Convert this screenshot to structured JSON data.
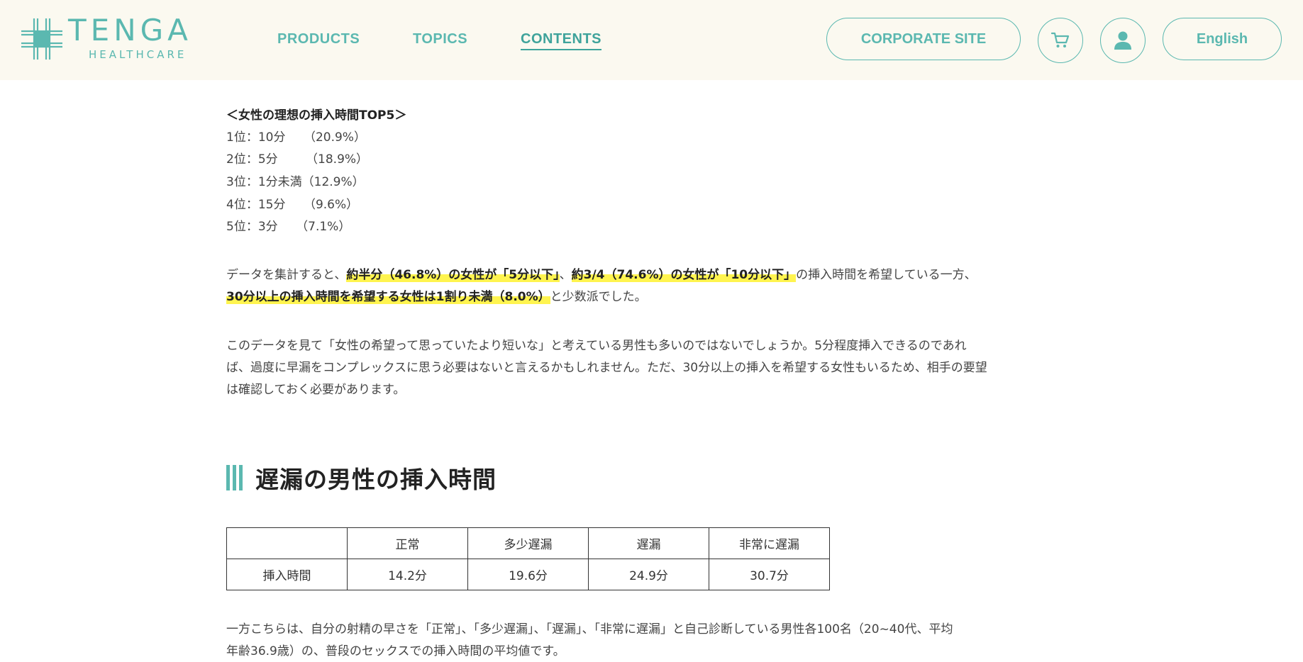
{
  "header": {
    "logo": {
      "word": "TENGA",
      "sub": "HEALTHCARE",
      "icon": "tenga-cross-icon"
    },
    "nav": [
      {
        "label": "PRODUCTS",
        "active": false
      },
      {
        "label": "TOPICS",
        "active": false
      },
      {
        "label": "CONTENTS",
        "active": true
      }
    ],
    "corporate_site": "CORPORATE SITE",
    "cart_icon": "cart-icon",
    "account_icon": "user-icon",
    "language": "English",
    "accent_color": "#5bb8b0",
    "background_color": "#fbf9f0"
  },
  "ranking": {
    "title": "＜女性の理想の挿入時間TOP5＞",
    "items": [
      "1位：10分　　（20.9%）",
      "2位：5分　　 （18.9%）",
      "3位：1分未満（12.9%）",
      "4位：15分　　（9.6%）",
      "5位：3分　　（7.1%）"
    ]
  },
  "summary": {
    "line1_pre": "データを集計すると、",
    "line1_hl1": "約半分（46.8%）の女性が「5分以下」",
    "line1_mid": "、",
    "line1_hl2": "約3/4（74.6%）の女性が「10分以下」",
    "line1_post": "の挿入時間を希望している一方、",
    "line2_hl": "30分以上の挿入時間を希望する女性は1割り未満（8.0%）",
    "line2_post": "と少数派でした。",
    "highlight_color": "#fff44f"
  },
  "commentary": [
    "このデータを見て「女性の希望って思っていたより短いな」と考えている男性も多いのではないでしょうか。5分程度挿入できるのであれ",
    "ば、過度に早漏をコンプレックスに思う必要はないと言えるかもしれません。ただ、30分以上の挿入を希望する女性もいるため、相手の要望",
    "は確認しておく必要があります。"
  ],
  "section": {
    "heading": "遅漏の男性の挿入時間"
  },
  "table": {
    "headers": [
      "",
      "正常",
      "多少遅漏",
      "遅漏",
      "非常に遅漏"
    ],
    "rows": [
      [
        "挿入時間",
        "14.2分",
        "19.6分",
        "24.9分",
        "30.7分"
      ]
    ]
  },
  "footer_text": [
    "一方こちらは、自分の射精の早さを「正常」、「多少遅漏」、「遅漏」、「非常に遅漏」と自己診断している男性各100名（20~40代、平均",
    "年齢36.9歳）の、普段のセックスでの挿入時間の平均値です。"
  ]
}
